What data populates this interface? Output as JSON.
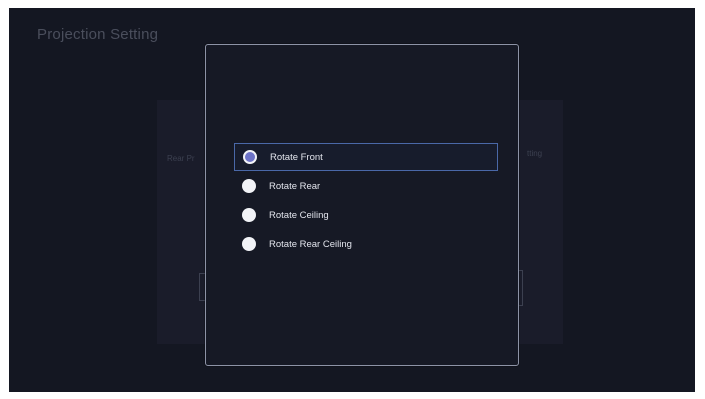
{
  "background": {
    "title": "Projection Setting",
    "left_label": "Rear Pr",
    "right_label": "tting"
  },
  "dialog": {
    "options": [
      {
        "label": "Rotate Front",
        "selected": true,
        "focused": true
      },
      {
        "label": "Rotate Rear",
        "selected": false,
        "focused": false
      },
      {
        "label": "Rotate Ceiling",
        "selected": false,
        "focused": false
      },
      {
        "label": "Rotate Rear Ceiling",
        "selected": false,
        "focused": false
      }
    ]
  },
  "colors": {
    "screen_bg": "#141722",
    "dialog_border": "#8d93a6",
    "focus_border": "#4a68a8",
    "radio_checked": "#6d73c7",
    "radio_unchecked": "#f2f3f7"
  }
}
